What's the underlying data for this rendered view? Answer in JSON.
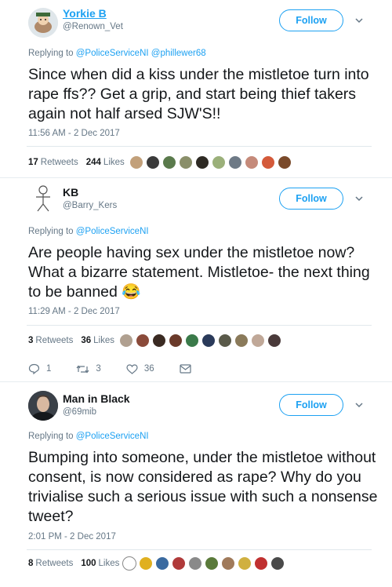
{
  "colors": {
    "accent": "#1da1f2",
    "text": "#14171a",
    "muted": "#657786"
  },
  "tweets": [
    {
      "name": "Yorkie B",
      "handle": "@Renown_Vet",
      "follow_label": "Follow",
      "reply_prefix": "Replying to ",
      "reply_to": "@PoliceServiceNI @phillewer68",
      "body": "Since when did a kiss under the mistletoe turn into rape ffs?? Get a grip, and start being thief takers again not half arsed SJW'S!!",
      "timestamp": "11:56 AM - 2 Dec 2017",
      "retweets": "17",
      "retweets_label": "Retweets",
      "likes": "244",
      "likes_label": "Likes"
    },
    {
      "name": "KB",
      "handle": "@Barry_Kers",
      "follow_label": "Follow",
      "reply_prefix": "Replying to ",
      "reply_to": "@PoliceServiceNI",
      "body": "Are people having sex under the mistletoe now? What a bizarre statement. Mistletoe- the next thing to be banned 😂",
      "timestamp": "11:29 AM - 2 Dec 2017",
      "retweets": "3",
      "retweets_label": "Retweets",
      "likes": "36",
      "likes_label": "Likes",
      "actions": {
        "replies": "1",
        "retweets": "3",
        "likes": "36"
      }
    },
    {
      "name": "Man in Black",
      "handle": "@69mib",
      "follow_label": "Follow",
      "reply_prefix": "Replying to ",
      "reply_to": "@PoliceServiceNI",
      "body": "Bumping into someone, under the mistletoe without consent, is now considered as rape? Why do you trivialise such a serious issue with such a nonsense tweet?",
      "timestamp": "2:01 PM - 2 Dec 2017",
      "retweets": "8",
      "retweets_label": "Retweets",
      "likes": "100",
      "likes_label": "Likes"
    }
  ]
}
